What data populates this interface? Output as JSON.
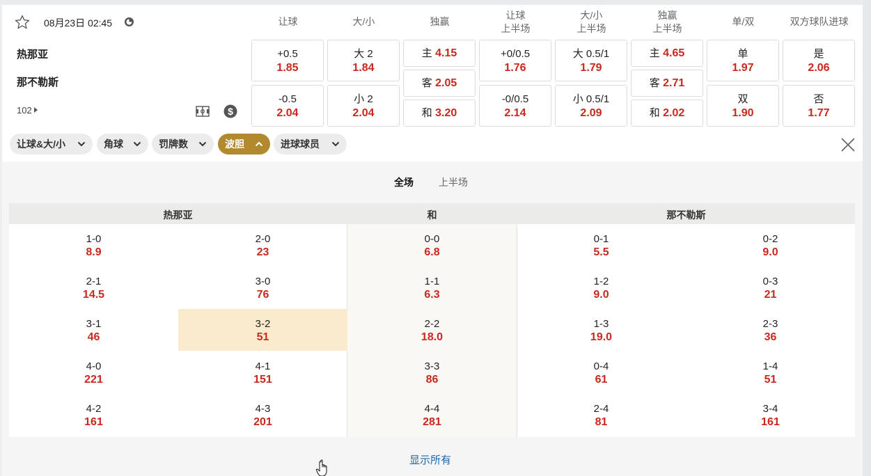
{
  "match": {
    "datetime": "08月23日 02:45",
    "home": "热那亚",
    "away": "那不勒斯",
    "more_count": "102"
  },
  "headers": [
    {
      "line1": "让球",
      "line2": ""
    },
    {
      "line1": "大/小",
      "line2": ""
    },
    {
      "line1": "独赢",
      "line2": ""
    },
    {
      "line1": "让球",
      "line2": "上半场"
    },
    {
      "line1": "大/小",
      "line2": "上半场"
    },
    {
      "line1": "独赢",
      "line2": "上半场"
    },
    {
      "line1": "单/双",
      "line2": ""
    },
    {
      "line1": "双方球队进球",
      "line2": ""
    }
  ],
  "markets": {
    "handicap": [
      {
        "label": "+0.5",
        "odd": "1.85"
      },
      {
        "label": "-0.5",
        "odd": "2.04"
      }
    ],
    "overunder": [
      {
        "label": "大 2",
        "odd": "1.84"
      },
      {
        "label": "小 2",
        "odd": "2.04"
      }
    ],
    "moneyline": [
      {
        "label": "主",
        "odd": "4.15"
      },
      {
        "label": "客",
        "odd": "2.05"
      },
      {
        "label": "和",
        "odd": "3.20"
      }
    ],
    "handicap_1h": [
      {
        "label": "+0/0.5",
        "odd": "1.76"
      },
      {
        "label": "-0/0.5",
        "odd": "2.14"
      }
    ],
    "overunder_1h": [
      {
        "label": "大 0.5/1",
        "odd": "1.79"
      },
      {
        "label": "小 0.5/1",
        "odd": "2.09"
      }
    ],
    "moneyline_1h": [
      {
        "label": "主",
        "odd": "4.65"
      },
      {
        "label": "客",
        "odd": "2.71"
      },
      {
        "label": "和",
        "odd": "2.02"
      }
    ],
    "oddeven": [
      {
        "label": "单",
        "odd": "1.97"
      },
      {
        "label": "双",
        "odd": "1.90"
      }
    ],
    "btts": [
      {
        "label": "是",
        "odd": "2.06"
      },
      {
        "label": "否",
        "odd": "1.77"
      }
    ]
  },
  "filters": [
    {
      "label": "让球&大/小",
      "active": false
    },
    {
      "label": "角球",
      "active": false
    },
    {
      "label": "罚牌数",
      "active": false
    },
    {
      "label": "波胆",
      "active": true
    },
    {
      "label": "进球球员",
      "active": false
    }
  ],
  "tabs": {
    "full": "全场",
    "first_half": "上半场"
  },
  "correct_score": {
    "headers": {
      "home": "热那亚",
      "draw": "和",
      "away": "那不勒斯"
    },
    "columns": [
      [
        {
          "score": "1-0",
          "odd": "8.9"
        },
        {
          "score": "2-1",
          "odd": "14.5"
        },
        {
          "score": "3-1",
          "odd": "46"
        },
        {
          "score": "4-0",
          "odd": "221"
        },
        {
          "score": "4-2",
          "odd": "161"
        }
      ],
      [
        {
          "score": "2-0",
          "odd": "23"
        },
        {
          "score": "3-0",
          "odd": "76"
        },
        {
          "score": "3-2",
          "odd": "51"
        },
        {
          "score": "4-1",
          "odd": "151"
        },
        {
          "score": "4-3",
          "odd": "201"
        }
      ],
      [
        {
          "score": "0-0",
          "odd": "6.8"
        },
        {
          "score": "1-1",
          "odd": "6.3"
        },
        {
          "score": "2-2",
          "odd": "18.0"
        },
        {
          "score": "3-3",
          "odd": "86"
        },
        {
          "score": "4-4",
          "odd": "281"
        }
      ],
      [
        {
          "score": "0-1",
          "odd": "5.5"
        },
        {
          "score": "1-2",
          "odd": "9.0"
        },
        {
          "score": "1-3",
          "odd": "19.0"
        },
        {
          "score": "0-4",
          "odd": "61"
        },
        {
          "score": "2-4",
          "odd": "81"
        }
      ],
      [
        {
          "score": "0-2",
          "odd": "9.0"
        },
        {
          "score": "0-3",
          "odd": "21"
        },
        {
          "score": "2-3",
          "odd": "36"
        },
        {
          "score": "1-4",
          "odd": "51"
        },
        {
          "score": "3-4",
          "odd": "161"
        }
      ]
    ],
    "highlighted": "3-2"
  },
  "show_all": "显示所有",
  "colors": {
    "odd": "#c8281e",
    "active_pill": "#b18a2d",
    "highlight": "#faebcd",
    "link": "#2266aa"
  }
}
